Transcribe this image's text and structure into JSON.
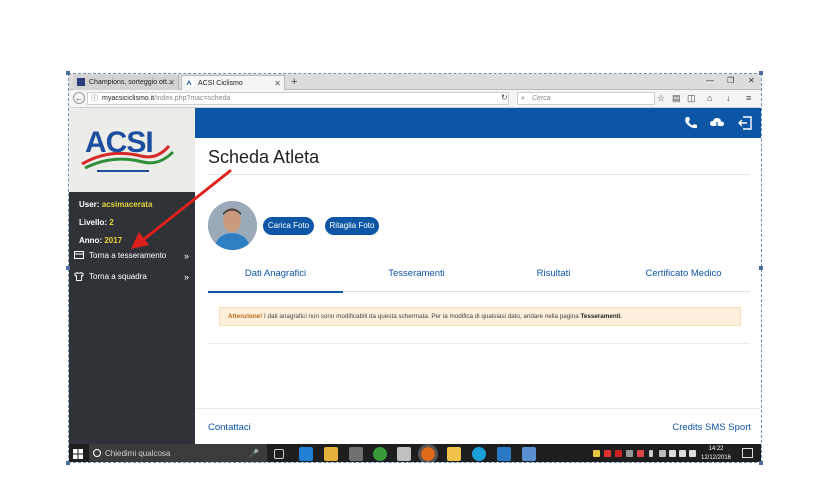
{
  "browser": {
    "tabs": [
      {
        "label": "Champions, sorteggio ott..."
      },
      {
        "label": "ACSI Ciclismo"
      }
    ],
    "url_host": "myacsiciclismo.it",
    "url_path": "/index.php?mac=scheda",
    "search_placeholder": "Cerca"
  },
  "sidebar": {
    "user_label": "User:",
    "user_value": "acsimacerata",
    "level_label": "Livello:",
    "level_value": "2",
    "year_label": "Anno:",
    "year_value": "2017",
    "items": [
      {
        "label": "Torna a tesseramento",
        "icon": "card-icon"
      },
      {
        "label": "Torna a squadra",
        "icon": "shirt-icon"
      }
    ],
    "logo_text": "ACSI"
  },
  "main": {
    "title": "Scheda Atleta",
    "upload_photo": "Carica Foto",
    "crop_photo": "Ritaglia Foto",
    "tabs": [
      {
        "label": "Dati Anagrafici"
      },
      {
        "label": "Tesseramenti"
      },
      {
        "label": "Risultati"
      },
      {
        "label": "Certificato Medico"
      }
    ],
    "alert_prefix": "Attenzione!",
    "alert_text": " I dati anagrafici non sono modificabili da questa schermata. Per la modifica di qualsiasi dato, andare nella pagina ",
    "alert_bold": "Tesseramenti",
    "alert_end": ".",
    "footer_left": "Contattaci",
    "footer_right": "Credits SMS Sport"
  },
  "taskbar": {
    "search_placeholder": "Chiedimi qualcosa",
    "time": "14:22",
    "date": "12/12/2016"
  },
  "colors": {
    "brand_blue": "#0d56a6",
    "sidebar_bg": "#2f3338",
    "highlight_yellow": "#e8d43b",
    "alert_bg": "#fcf0dc",
    "annotation_red": "#e0201b"
  }
}
